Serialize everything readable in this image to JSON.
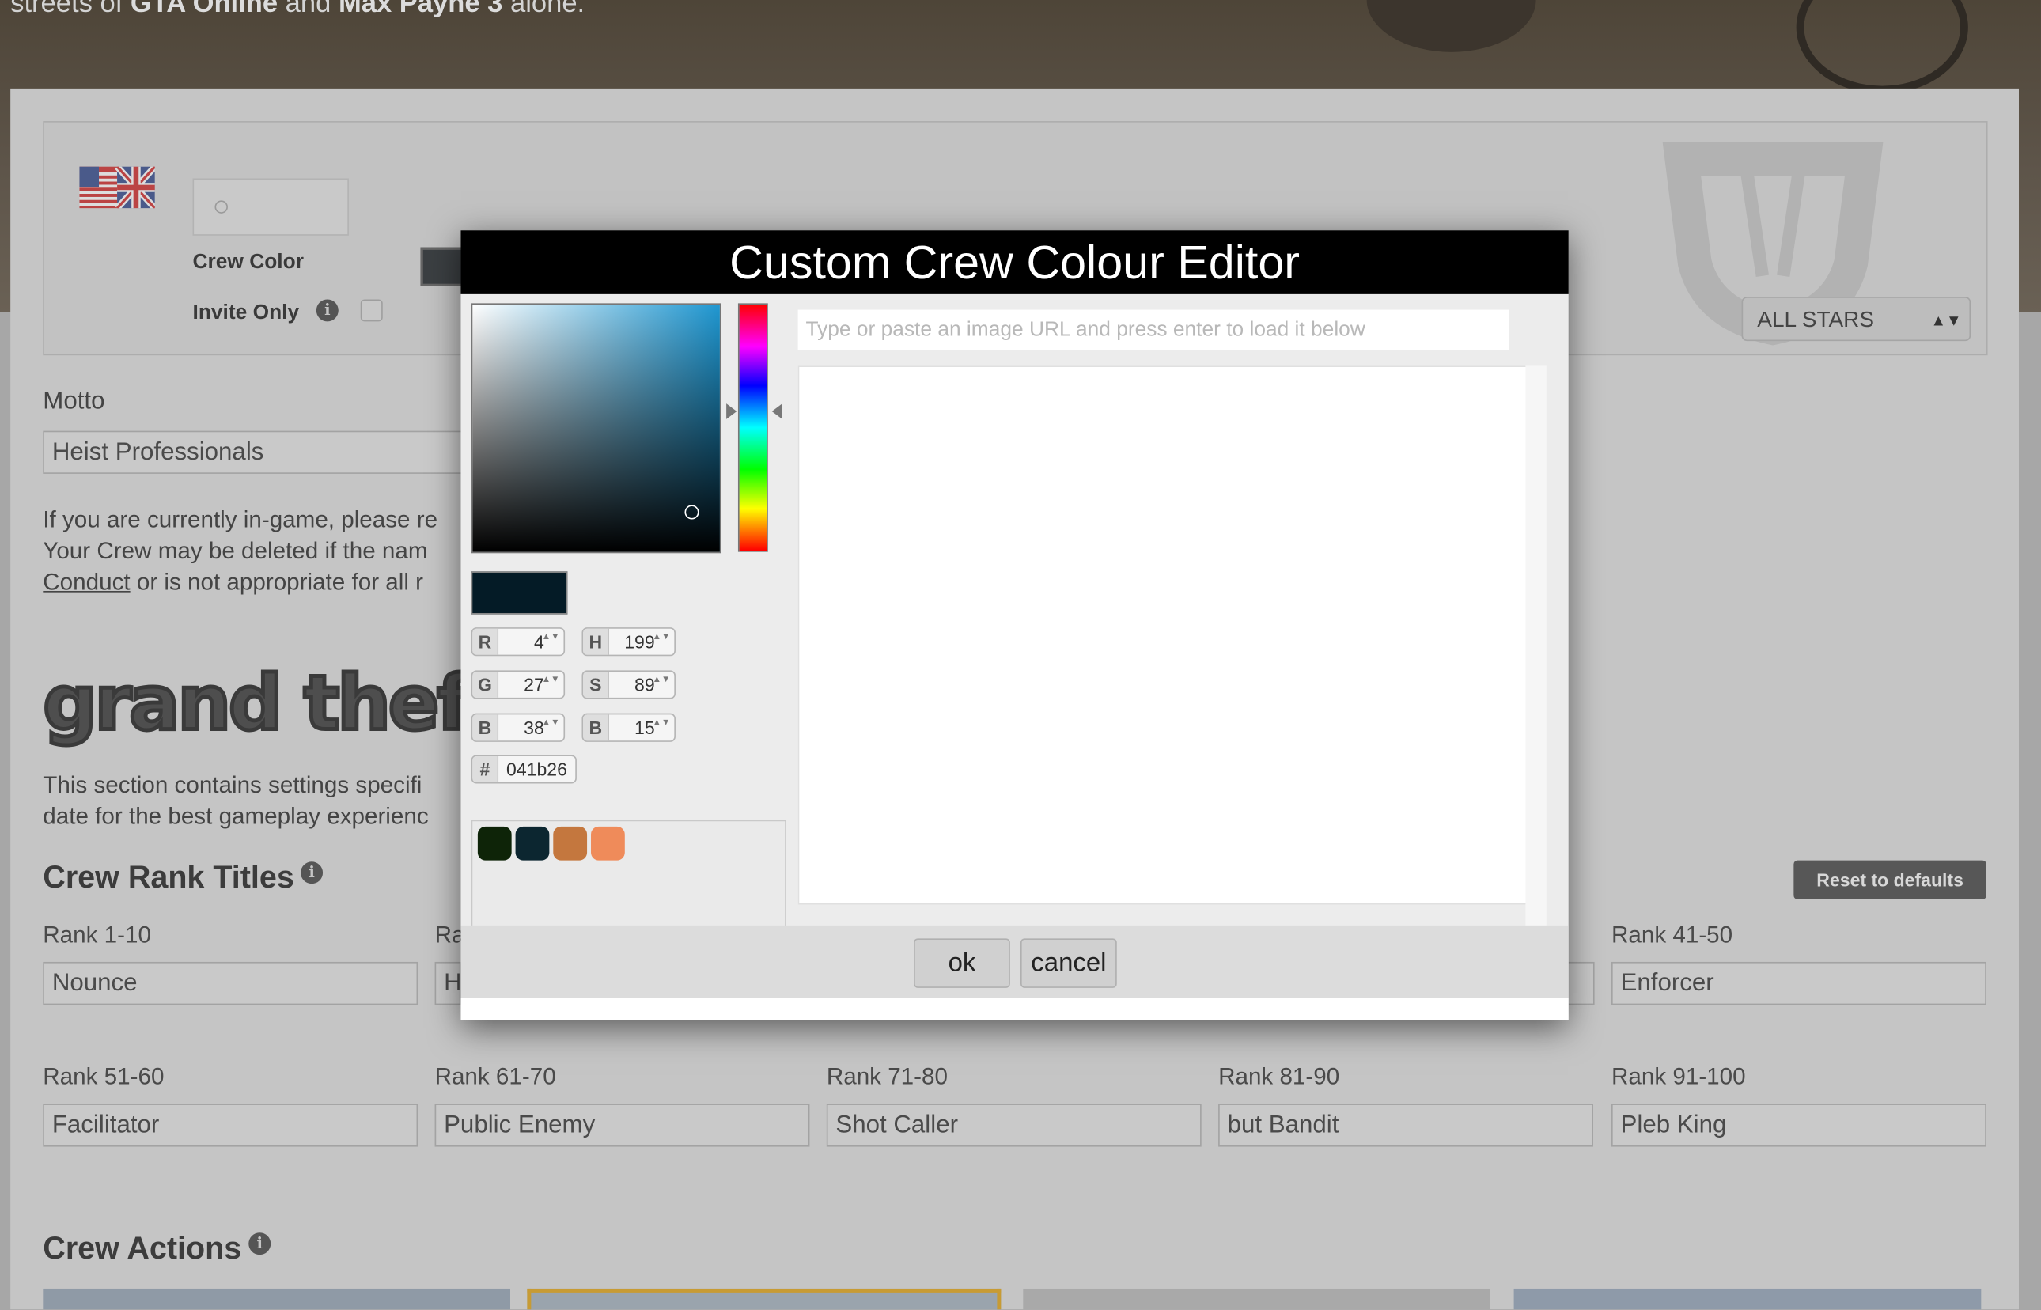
{
  "hero": {
    "text_prefix": "streets of ",
    "bold1": "GTA Online",
    "text_mid": " and ",
    "bold2": "Max Payne 3",
    "text_suffix": " alone."
  },
  "crew": {
    "crew_color_label": "Crew Color",
    "invite_only_label": "Invite Only",
    "info_glyph": "i",
    "status_select": "ALL STARS",
    "select_arrows": "▲▼"
  },
  "motto": {
    "label": "Motto",
    "value": "Heist Professionals",
    "note_line1": "If you are currently in-game, please re",
    "note_line2": "Your Crew may be deleted if the nam",
    "note_link": "Conduct",
    "note_line3_rest": " or is not appropriate for all r"
  },
  "gta": {
    "logo_text": "grand theft a",
    "desc_line1": "This section contains settings specifi",
    "desc_line2": "date for the best gameplay experienc"
  },
  "rank_titles": {
    "heading": "Crew Rank Titles",
    "reset_button": "Reset to defaults",
    "ranks": [
      {
        "label": "Rank 1-10",
        "value": "Nounce"
      },
      {
        "label": "Ra",
        "value": "H"
      },
      {
        "label": "Rank 41-50",
        "value": "Enforcer"
      },
      {
        "label": "Rank 51-60",
        "value": "Facilitator"
      },
      {
        "label": "Rank 61-70",
        "value": "Public Enemy"
      },
      {
        "label": "Rank 71-80",
        "value": "Shot Caller"
      },
      {
        "label": "Rank 81-90",
        "value": "but Bandit"
      },
      {
        "label": "Rank 91-100",
        "value": "Pleb King"
      }
    ]
  },
  "crew_actions": {
    "heading": "Crew Actions"
  },
  "editor": {
    "title": "Custom Crew Colour Editor",
    "current_color": "#041b26",
    "fields": {
      "r_key": "R",
      "r": "4",
      "g_key": "G",
      "g": "27",
      "b_key": "B",
      "b": "38",
      "h_key": "H",
      "h": "199",
      "s_key": "S",
      "s": "89",
      "v_key": "B",
      "v": "15",
      "hex_key": "#",
      "hex": "041b26"
    },
    "spin_glyph": "▲▼",
    "recent_colors": [
      "#0e2408",
      "#0c2630",
      "#c4773e",
      "#ef8b5a"
    ],
    "url_placeholder": "Type or paste an image URL and press enter to load it below",
    "ok_button": "ok",
    "cancel_button": "cancel"
  },
  "colors": {
    "accent_card_border": "#c79b34",
    "dialog_title_bg": "#000000"
  }
}
